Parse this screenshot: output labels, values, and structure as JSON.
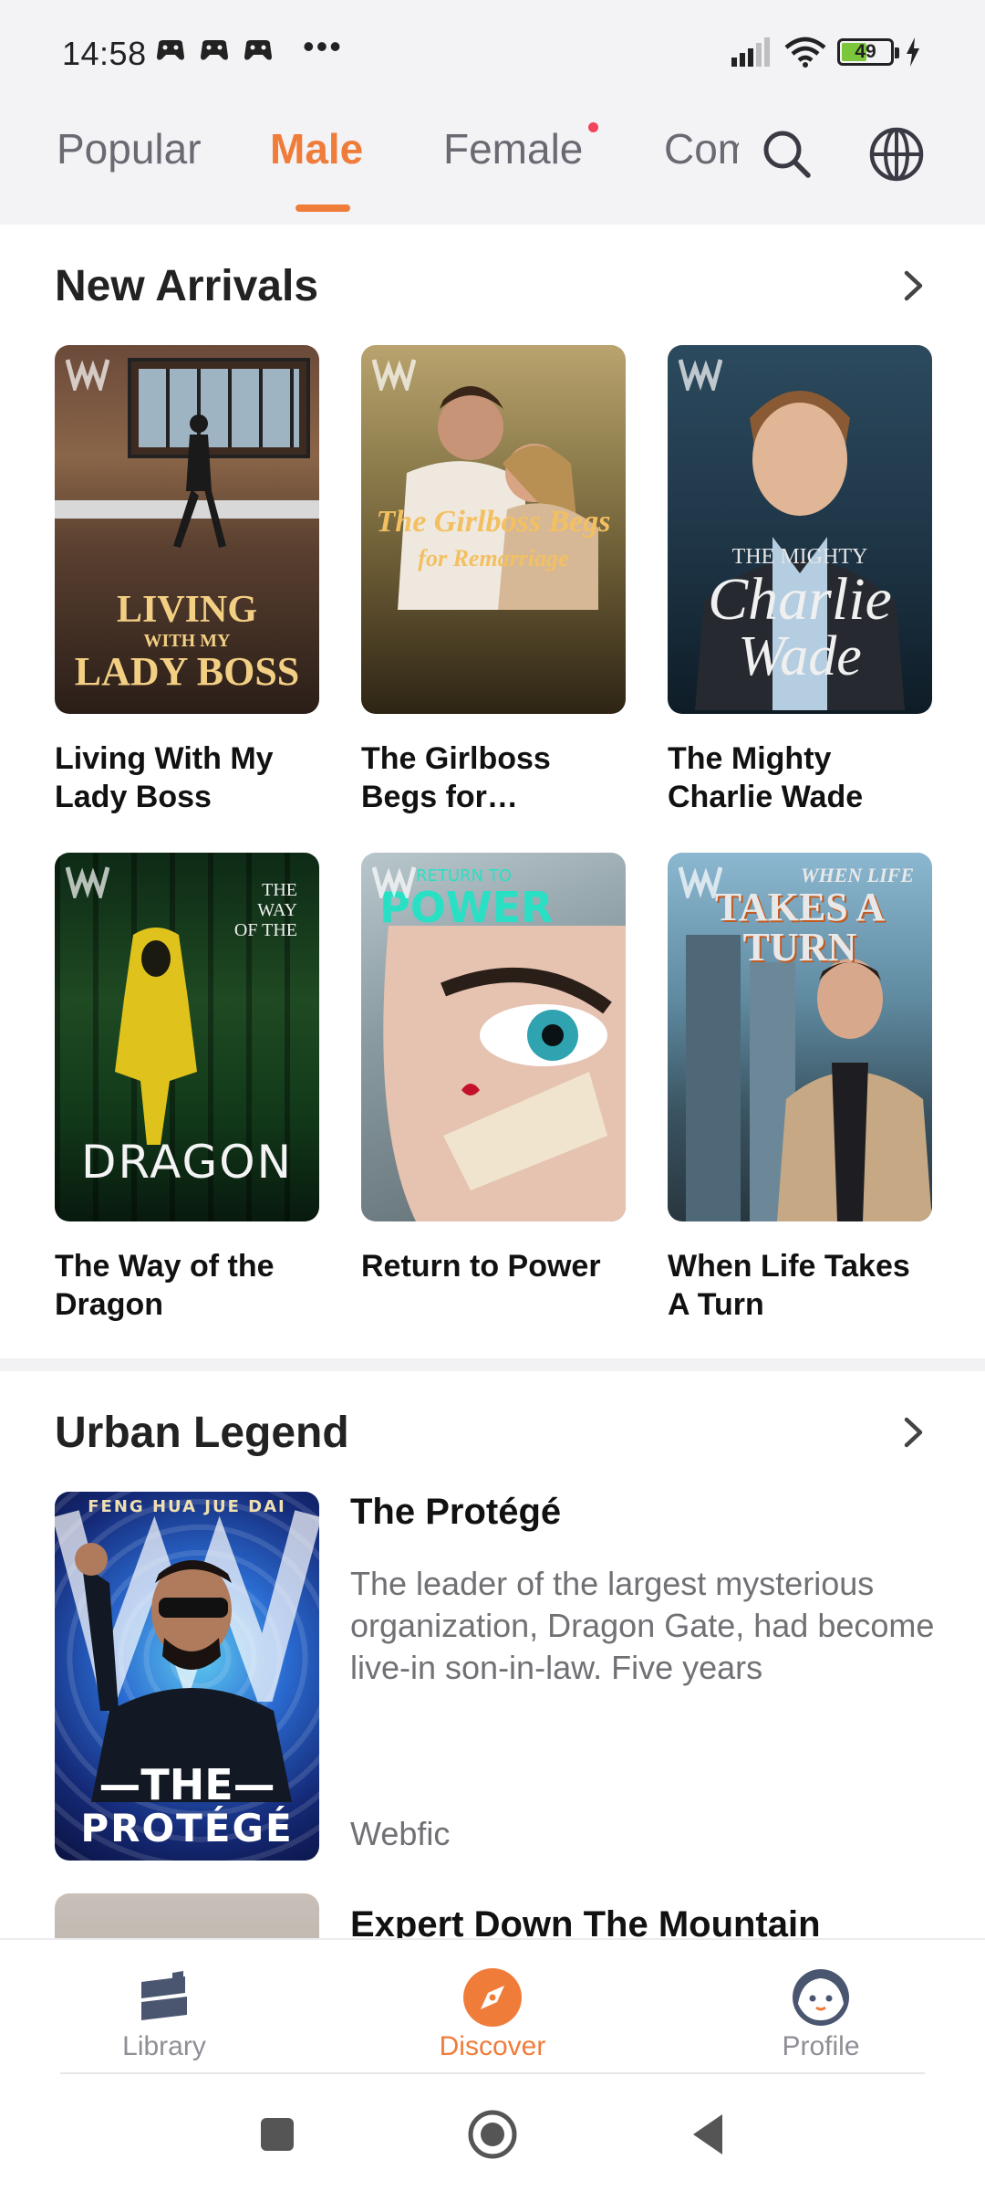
{
  "status_bar": {
    "time": "14:58",
    "more": "•••",
    "battery_level": "49",
    "battery_fraction": 0.49,
    "notification_icons": [
      "game-controller-icon",
      "game-controller-icon",
      "game-controller-icon"
    ]
  },
  "tabs": [
    {
      "label": "Popular",
      "active": false
    },
    {
      "label": "Male",
      "active": true
    },
    {
      "label": "Female",
      "active": false,
      "badge": true
    },
    {
      "label": "Comics",
      "active": false
    }
  ],
  "header_icons": [
    "search-icon",
    "globe-icon"
  ],
  "new_arrivals": {
    "title": "New Arrivals",
    "books": [
      {
        "title": "Living With My Lady Boss",
        "cover_line1": "LIVING",
        "cover_line2": "WITH MY",
        "cover_line3": "LADY BOSS"
      },
      {
        "title": "The Girlboss Begs for Remarriage",
        "cover_line1": "The Girlboss Begs",
        "cover_line2": "for Remarriage"
      },
      {
        "title": "The Mighty Charlie Wade",
        "cover_line1": "THE MIGHTY",
        "cover_line2": "Charlie",
        "cover_line3": "Wade"
      },
      {
        "title": "The Way of the Dragon",
        "cover_line1": "THE",
        "cover_line2": "WAY",
        "cover_line3": "OF THE",
        "cover_line4": "DRAGON"
      },
      {
        "title": "Return to Power",
        "cover_line1": "RETURN TO",
        "cover_line2": "POWER"
      },
      {
        "title": "When Life Takes A Turn",
        "cover_line1": "WHEN LIFE",
        "cover_line2": "TAKES A TURN"
      }
    ]
  },
  "urban_legend": {
    "title": "Urban Legend",
    "items": [
      {
        "title": "The Protégé",
        "description": "The leader of the largest mysterious organization, Dragon Gate, had become live-in son-in-law. Five years",
        "author": "Webfic",
        "cover_top": "FENG HUA JUE DAI",
        "cover_line1": "—THE—",
        "cover_line2": "PROTÉGÉ"
      },
      {
        "title": "Expert Down The Mountain"
      }
    ]
  },
  "bottom_nav": [
    {
      "label": "Library",
      "icon": "library-icon",
      "active": false
    },
    {
      "label": "Discover",
      "icon": "compass-icon",
      "active": true
    },
    {
      "label": "Profile",
      "icon": "profile-avatar-icon",
      "active": false
    }
  ],
  "colors": {
    "accent": "#f07c3a",
    "badge": "#f0455b",
    "inactive": "#8e8e96"
  }
}
